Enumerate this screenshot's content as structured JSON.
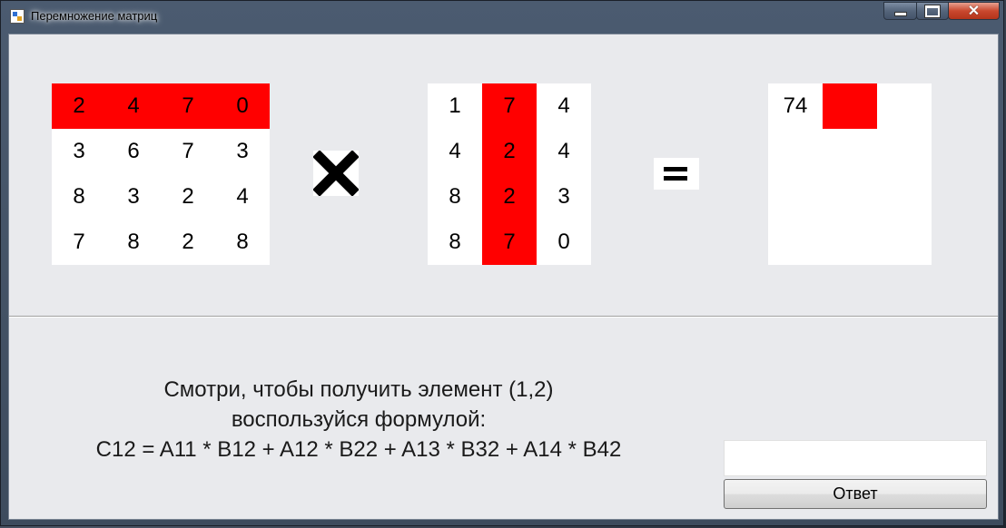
{
  "window": {
    "title": "Перемножение матриц",
    "controls": {
      "minimize": "—",
      "maximize": "□",
      "close": "✕"
    }
  },
  "matrix_a": {
    "rows": [
      [
        "2",
        "4",
        "7",
        "0"
      ],
      [
        "3",
        "6",
        "7",
        "3"
      ],
      [
        "8",
        "3",
        "2",
        "4"
      ],
      [
        "7",
        "8",
        "2",
        "8"
      ]
    ],
    "highlight_row": 0
  },
  "operator_multiply": "✖",
  "matrix_b": {
    "rows": [
      [
        "1",
        "7",
        "4"
      ],
      [
        "4",
        "2",
        "4"
      ],
      [
        "8",
        "2",
        "3"
      ],
      [
        "8",
        "7",
        "0"
      ]
    ],
    "highlight_col": 1
  },
  "operator_equals": "=",
  "matrix_c": {
    "cells": [
      "74",
      ""
    ],
    "highlight_index": 1
  },
  "hint": {
    "line1": "Смотри, чтобы получить элемент (1,2)",
    "line2": "воспользуйся формулой:",
    "line3": "C12 = A11 * B12 + A12 * B22 + A13 * B32 + A14 * B42"
  },
  "answer": {
    "value": "",
    "button_label": "Ответ"
  },
  "colors": {
    "highlight": "#ff0000",
    "background": "#e9eaed"
  }
}
